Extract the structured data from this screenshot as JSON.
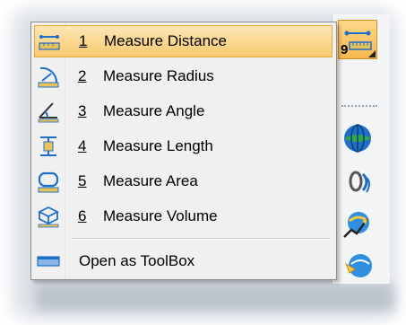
{
  "menu": {
    "items": [
      {
        "number": "1",
        "label": "Measure Distance",
        "icon": "measure-distance-icon",
        "highlighted": true
      },
      {
        "number": "2",
        "label": "Measure Radius",
        "icon": "measure-radius-icon"
      },
      {
        "number": "3",
        "label": "Measure Angle",
        "icon": "measure-angle-icon"
      },
      {
        "number": "4",
        "label": "Measure Length",
        "icon": "measure-length-icon"
      },
      {
        "number": "5",
        "label": "Measure Area",
        "icon": "measure-area-icon"
      },
      {
        "number": "6",
        "label": "Measure Volume",
        "icon": "measure-volume-icon"
      }
    ],
    "footer": {
      "label": "Open as ToolBox",
      "icon": "toolbox-icon"
    }
  },
  "toolbar": {
    "active_badge": "9",
    "buttons": [
      "measure-distance-icon",
      "globe-icon",
      "rotate-view-icon",
      "fly-through-icon",
      "navigate-icon"
    ]
  },
  "colors": {
    "highlight": "#f9c970",
    "highlight_border": "#e5a83a",
    "menu_bg": "#f0f0f0",
    "icon_blue": "#1f6fc8"
  }
}
